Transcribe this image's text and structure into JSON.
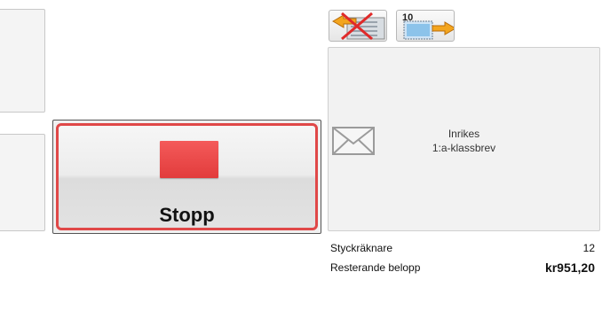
{
  "stop_button": {
    "label": "Stopp",
    "icon": "stop-square-icon",
    "accent": "#e04848"
  },
  "toolbar": {
    "remove_icon": "remove-postage-icon",
    "add_icon": "add-postage-icon",
    "add_badge": "10"
  },
  "letter": {
    "icon": "envelope-icon",
    "line1": "Inrikes",
    "line2": "1:a-klassbrev"
  },
  "counter": {
    "label": "Styckräknare",
    "value": "12"
  },
  "remaining": {
    "label": "Resterande belopp",
    "value": "kr951,20"
  }
}
